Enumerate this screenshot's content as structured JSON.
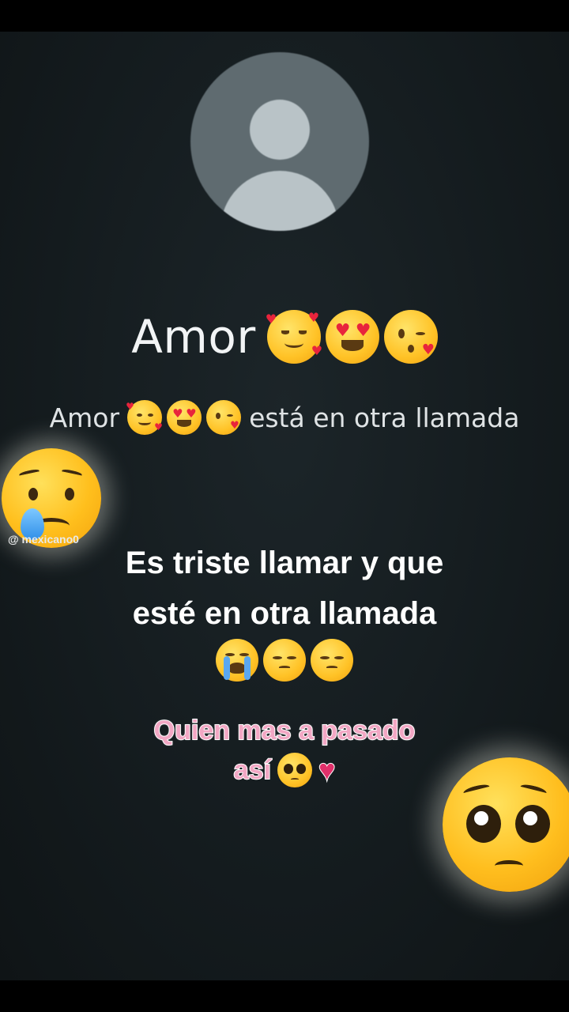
{
  "call": {
    "contact_name": "Amor",
    "status_name": "Amor",
    "status_text": "está en otra llamada",
    "name_emojis": [
      "smiling-face-with-hearts",
      "heart-eyes",
      "face-blowing-kiss"
    ]
  },
  "overlay": {
    "watermark": "@          mexicano0",
    "caption_line1": "Es triste llamar y que",
    "caption_line2": "esté en otra llamada",
    "caption_emojis": [
      "loudly-crying",
      "pensive",
      "pensive"
    ],
    "pink_line1": "Quien mas a pasado",
    "pink_line2": "así"
  },
  "colors": {
    "background": "#141b1e",
    "avatar": "#5f6b70",
    "pink_text": "#f2a7c4"
  }
}
